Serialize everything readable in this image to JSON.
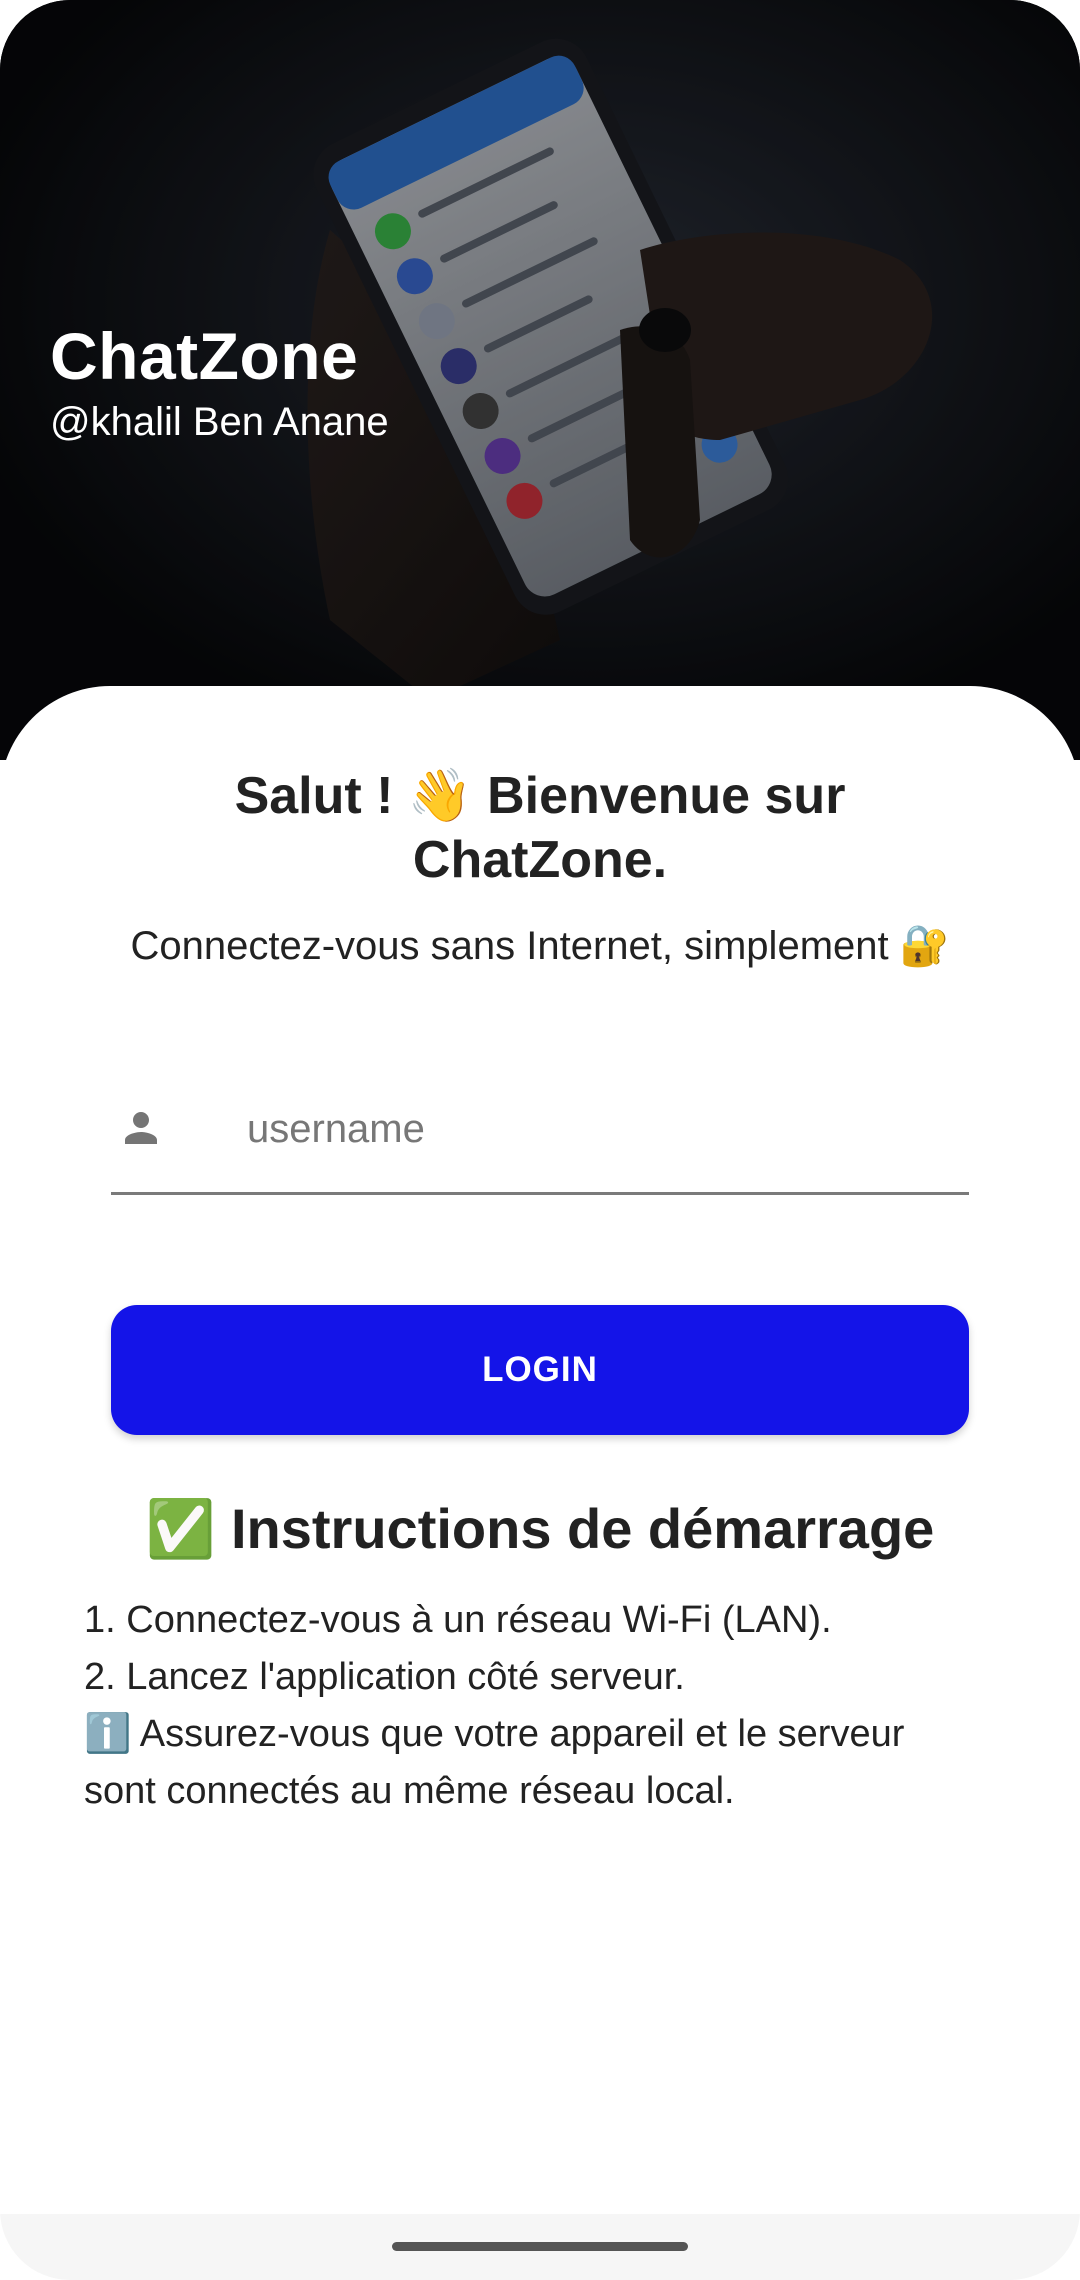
{
  "hero": {
    "title": "ChatZone",
    "subtitle": "@khalil Ben Anane"
  },
  "welcome": {
    "title": "Salut ! 👋 Bienvenue sur ChatZone.",
    "tagline": "Connectez-vous sans Internet, simplement 🔐"
  },
  "form": {
    "username_placeholder": "username",
    "username_value": "",
    "username_icon": "person-icon",
    "login_label": "LOGIN"
  },
  "instructions": {
    "title": "✅ Instructions de démarrage",
    "items": [
      "1. Connectez-vous à un réseau Wi-Fi (LAN).",
      "2. Lancez l'application côté serveur.",
      "ℹ️ Assurez-vous que votre appareil et le serveur sont connectés au même réseau local."
    ]
  },
  "colors": {
    "accent": "#1414e8",
    "hero_background": "#0b0c0f",
    "text": "#222222"
  }
}
